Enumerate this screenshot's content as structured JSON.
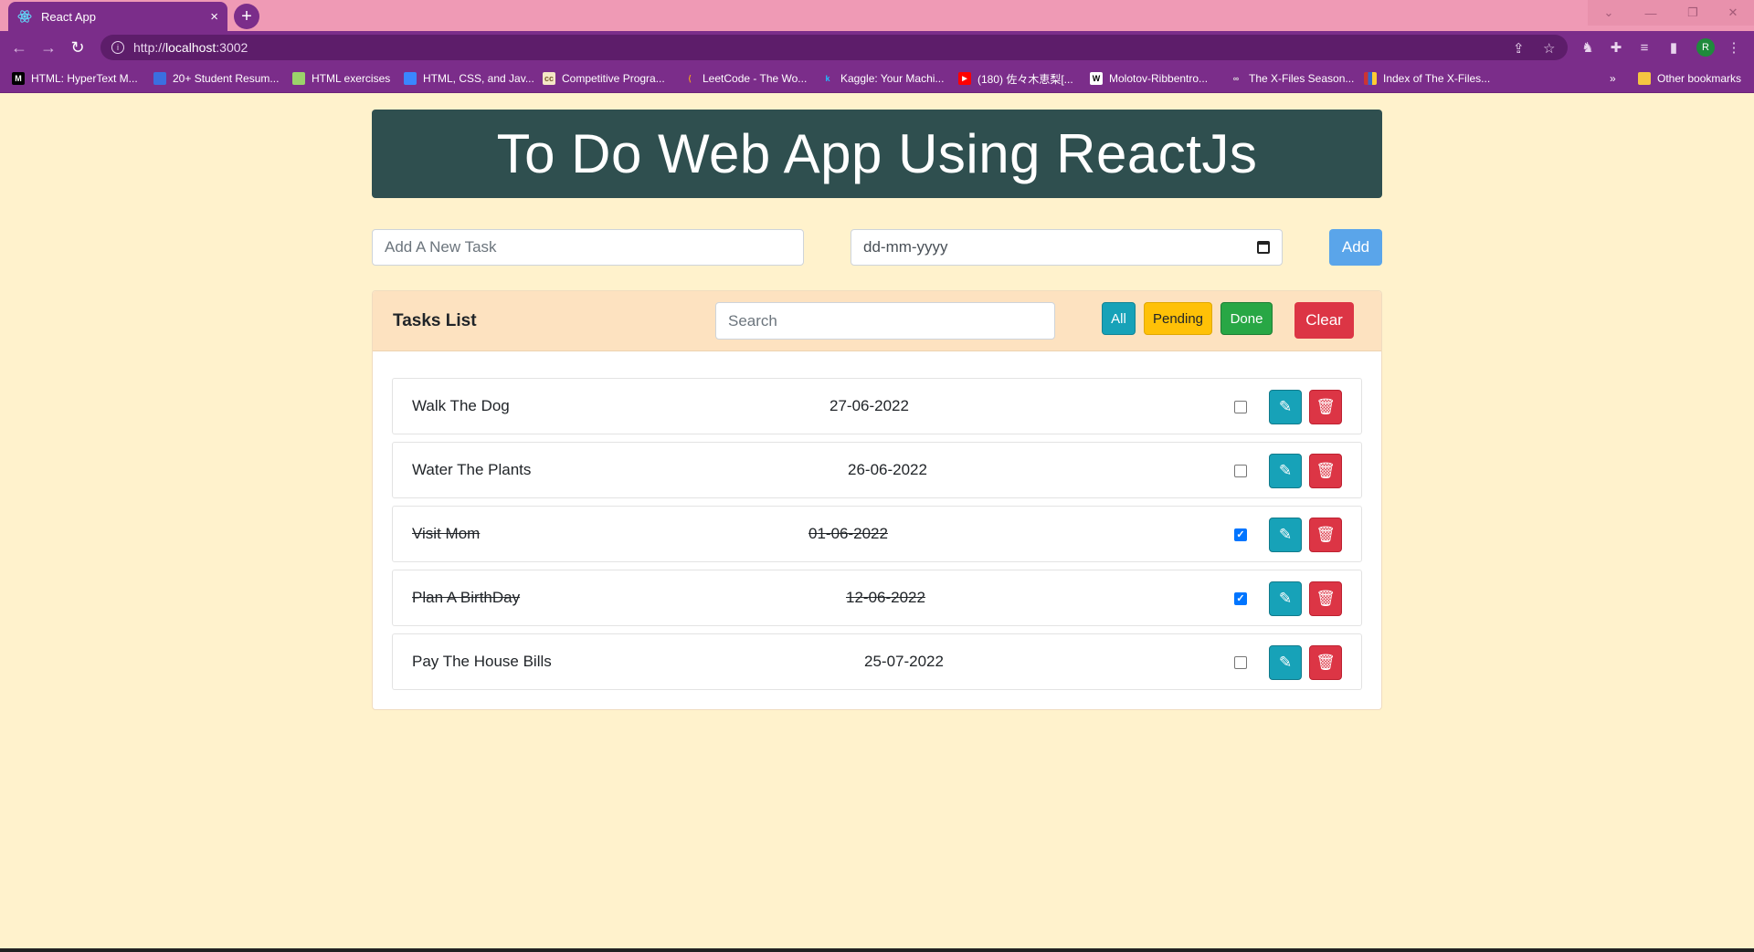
{
  "browser": {
    "tab_title": "React App",
    "tab_close": "×",
    "new_tab": "+",
    "url_scheme": "http://",
    "url_host": "localhost",
    "url_port": ":3002",
    "profile_initial": "R",
    "bookmarks": [
      {
        "label": "HTML: HyperText M...",
        "icon": "mdn-icon",
        "color": "#000000",
        "glyph": "M"
      },
      {
        "label": "20+ Student Resum...",
        "icon": "resume-icon",
        "color": "#3b6fe0",
        "glyph": ""
      },
      {
        "label": "HTML exercises",
        "icon": "exercises-icon",
        "color": "#9bd36a",
        "glyph": ""
      },
      {
        "label": "HTML, CSS, and Jav...",
        "icon": "html-css-icon",
        "color": "#3a86ff",
        "glyph": ""
      },
      {
        "label": "Competitive Progra...",
        "icon": "cc-icon",
        "color": "#7a5c2e",
        "glyph": "cc"
      },
      {
        "label": "LeetCode - The Wo...",
        "icon": "leetcode-icon",
        "color": "#f0a020",
        "glyph": ""
      },
      {
        "label": "Kaggle: Your Machi...",
        "icon": "kaggle-icon",
        "color": "#20beff",
        "glyph": "k"
      },
      {
        "label": "(180) 佐々木恵梨[...",
        "icon": "youtube-icon",
        "color": "#ff0000",
        "glyph": ""
      },
      {
        "label": "Molotov-Ribbentro...",
        "icon": "wikipedia-icon",
        "color": "#ffffff",
        "glyph": "W"
      },
      {
        "label": "The X-Files Season...",
        "icon": "link-icon",
        "color": "#dddddd",
        "glyph": ""
      },
      {
        "label": "Index of The X-Files...",
        "icon": "index-icon",
        "color": "#c33",
        "glyph": ""
      }
    ],
    "overflow": "»",
    "other_bookmarks": "Other bookmarks"
  },
  "app": {
    "title": "To Do Web App Using ReactJs",
    "task_placeholder": "Add A New Task",
    "date_placeholder": "dd-mm-yyyy",
    "add_label": "Add",
    "list_title": "Tasks List",
    "search_placeholder": "Search",
    "filters": {
      "all": "All",
      "pending": "Pending",
      "done": "Done",
      "clear": "Clear"
    },
    "tasks": [
      {
        "name": "Walk The Dog",
        "date": "27-06-2022",
        "done": false
      },
      {
        "name": "Water The Plants",
        "date": "26-06-2022",
        "done": false
      },
      {
        "name": "Visit Mom",
        "date": "01-06-2022",
        "done": true
      },
      {
        "name": "Plan A BirthDay",
        "date": "12-06-2022",
        "done": true
      },
      {
        "name": "Pay The House Bills",
        "date": "25-07-2022",
        "done": false
      }
    ],
    "colors": {
      "background": "#fff2cc",
      "header_bg": "#2f4f4f",
      "card_header_bg": "#fde2c0",
      "info": "#17a2b8",
      "warning": "#ffc107",
      "success": "#28a745",
      "danger": "#dc3545",
      "primary_light": "#5aa5ea"
    }
  }
}
